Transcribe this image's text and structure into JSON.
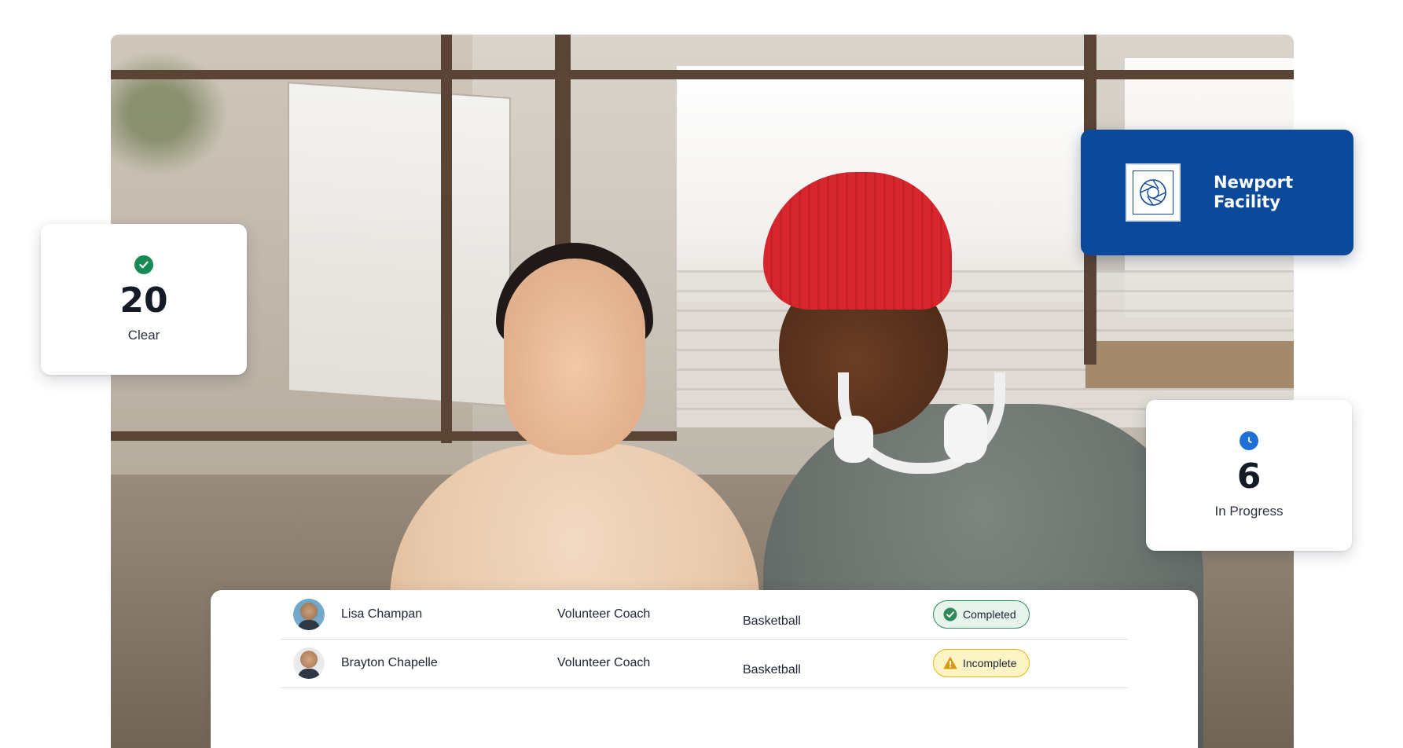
{
  "facility": {
    "name": "Newport Facility",
    "logo_icon": "camera-aperture-icon",
    "background_color": "#0b4a9b"
  },
  "stats": {
    "clear": {
      "count": "20",
      "label": "Clear",
      "icon": "check-circle-icon",
      "color": "#188a56"
    },
    "in_progress": {
      "count": "6",
      "label": "In Progress",
      "icon": "clock-icon",
      "color": "#1f6fd6"
    }
  },
  "table": {
    "rows": [
      {
        "name": "Lisa Champan",
        "role": "Volunteer Coach",
        "sport": "Basketball",
        "status": "Completed",
        "status_icon": "check-circle-icon",
        "status_color": "#2f8a5b"
      },
      {
        "name": "Brayton Chapelle",
        "role": "Volunteer Coach",
        "sport": "Basketball",
        "status": "Incomplete",
        "status_icon": "warning-triangle-icon",
        "status_color": "#e4b419"
      }
    ]
  }
}
